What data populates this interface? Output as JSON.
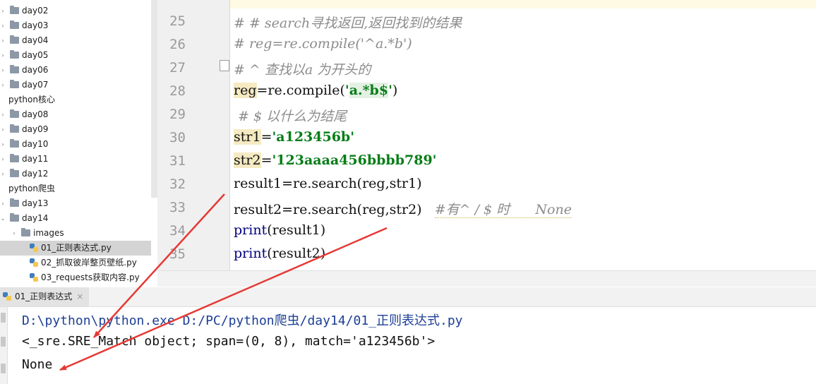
{
  "tree": {
    "items": [
      {
        "label": "day02",
        "kind": "folder",
        "indent": 0,
        "arrow": "›"
      },
      {
        "label": "day03",
        "kind": "folder",
        "indent": 0,
        "arrow": "›"
      },
      {
        "label": "day04",
        "kind": "folder",
        "indent": 0,
        "arrow": "›"
      },
      {
        "label": "day05",
        "kind": "folder",
        "indent": 0,
        "arrow": "›"
      },
      {
        "label": "day06",
        "kind": "folder",
        "indent": 0,
        "arrow": "›"
      },
      {
        "label": "day07",
        "kind": "folder",
        "indent": 0,
        "arrow": "›"
      },
      {
        "label": "python核心",
        "kind": "group",
        "indent": 0,
        "arrow": ""
      },
      {
        "label": "day08",
        "kind": "folder",
        "indent": 0,
        "arrow": "›"
      },
      {
        "label": "day09",
        "kind": "folder",
        "indent": 0,
        "arrow": "›"
      },
      {
        "label": "day10",
        "kind": "folder",
        "indent": 0,
        "arrow": "›"
      },
      {
        "label": "day11",
        "kind": "folder",
        "indent": 0,
        "arrow": "›"
      },
      {
        "label": "day12",
        "kind": "folder",
        "indent": 0,
        "arrow": "›"
      },
      {
        "label": "python爬虫",
        "kind": "group",
        "indent": 0,
        "arrow": ""
      },
      {
        "label": "day13",
        "kind": "folder",
        "indent": 0,
        "arrow": "›"
      },
      {
        "label": "day14",
        "kind": "folder",
        "indent": 0,
        "arrow": "⌄"
      },
      {
        "label": "images",
        "kind": "folder",
        "indent": 1,
        "arrow": "›"
      },
      {
        "label": "01_正则表达式.py",
        "kind": "py",
        "indent": 2,
        "arrow": "",
        "selected": true
      },
      {
        "label": "02_抓取彼岸整页壁纸.py",
        "kind": "py",
        "indent": 2,
        "arrow": ""
      },
      {
        "label": "03_requests获取内容.py",
        "kind": "py",
        "indent": 2,
        "arrow": ""
      }
    ]
  },
  "editor": {
    "line_numbers": [
      "25",
      "26",
      "27",
      "28",
      "29",
      "30",
      "31",
      "32",
      "33",
      "34",
      "35"
    ],
    "lines": {
      "l25": "# # search寻找返回,返回找到的结果",
      "l26": "# reg=re.compile('^a.*b')",
      "l27": "# ^ 查找以a 为开头的",
      "l28_var": "reg",
      "l28_mid": "=re.compile(",
      "l28_q1": "'",
      "l28_rx": "a.*b$",
      "l28_q2": "'",
      "l28_end": ")",
      "l29": " # $ 以什么为结尾",
      "l30_var": "str1",
      "l30_eq": "=",
      "l30_str": "'a123456b'",
      "l31_var": "str2",
      "l31_eq": "=",
      "l31_str": "'123aaaa456bbbb789'",
      "l32": "result1=re.search(reg,str1)",
      "l33": "result2=re.search(reg,str2)",
      "l33_comment": "#有^ / $ 时      None",
      "l34_fn": "print",
      "l34_arg": "(result1)",
      "l35_fn": "print",
      "l35_arg": "(result2)"
    }
  },
  "run": {
    "tab_label": "01_正则表达式",
    "tab_close": "×",
    "output": [
      "D:\\python\\python.exe D:/PC/python爬虫/day14/01_正则表达式.py",
      "<_sre.SRE_Match object; span=(0, 8), match='a123456b'>",
      "None"
    ]
  },
  "colors": {
    "annotation_arrow": "#e53935",
    "comment": "#8c8c8c",
    "string": "#067d17",
    "builtin": "#000080",
    "path_text": "#1c3f95"
  }
}
